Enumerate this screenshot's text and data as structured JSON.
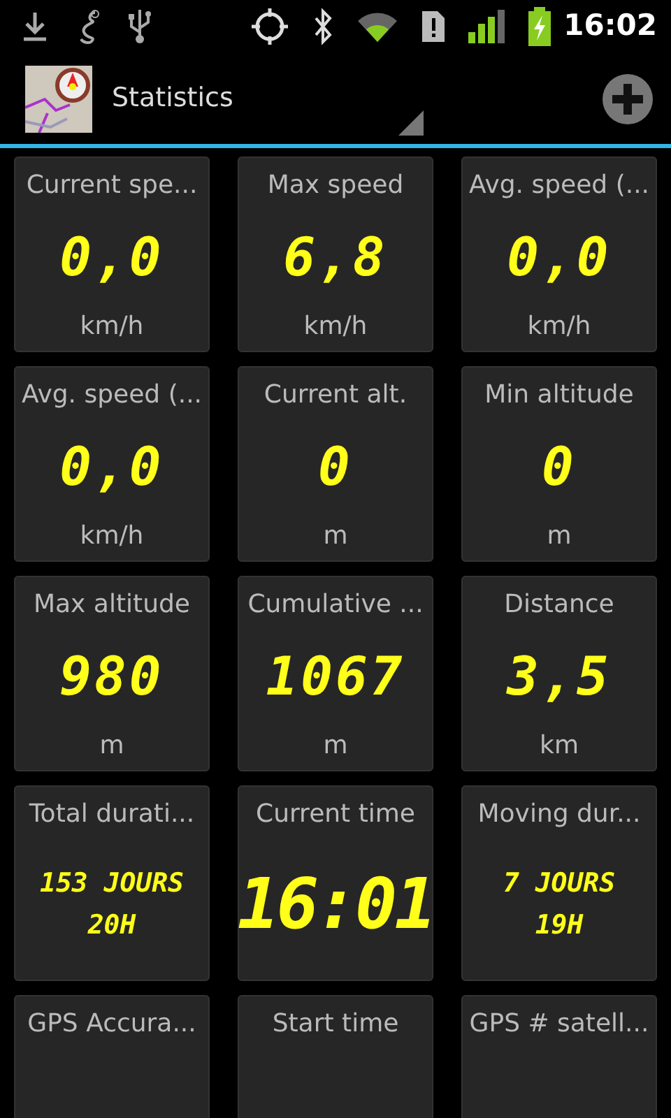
{
  "status_bar": {
    "time": "16:02"
  },
  "action_bar": {
    "title": "Statistics"
  },
  "tiles": [
    {
      "label": "Current spe...",
      "value": "0,0",
      "unit": "km/h",
      "kind": "number"
    },
    {
      "label": "Max speed",
      "value": "6,8",
      "unit": "km/h",
      "kind": "number"
    },
    {
      "label": "Avg. speed (...",
      "value": "0,0",
      "unit": "km/h",
      "kind": "number"
    },
    {
      "label": "Avg. speed (...",
      "value": "0,0",
      "unit": "km/h",
      "kind": "number"
    },
    {
      "label": "Current alt.",
      "value": "0",
      "unit": "m",
      "kind": "number"
    },
    {
      "label": "Min altitude",
      "value": "0",
      "unit": "m",
      "kind": "number"
    },
    {
      "label": "Max altitude",
      "value": "980",
      "unit": "m",
      "kind": "number"
    },
    {
      "label": "Cumulative ...",
      "value": "1067",
      "unit": "m",
      "kind": "number"
    },
    {
      "label": "Distance",
      "value": "3,5",
      "unit": "km",
      "kind": "number"
    },
    {
      "label": "Total durati...",
      "value": "153 JOURS\n20H",
      "kind": "duration"
    },
    {
      "label": "Current time",
      "value": "16:01",
      "kind": "time"
    },
    {
      "label": "Moving dur...",
      "value": "7 JOURS\n19H",
      "kind": "duration"
    },
    {
      "label": "GPS Accura...",
      "kind": "number"
    },
    {
      "label": "Start time",
      "kind": "number"
    },
    {
      "label": "GPS # satell...",
      "kind": "number"
    }
  ]
}
